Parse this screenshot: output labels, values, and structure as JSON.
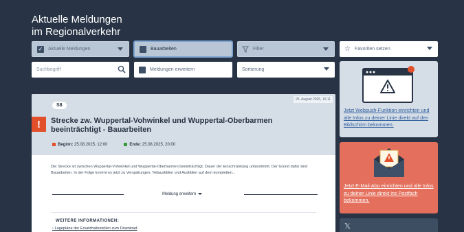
{
  "header": {
    "title_line1": "Aktuelle Meldungen",
    "title_line2": "im Regionalverkehr"
  },
  "filters": {
    "aktuelle": {
      "label": "Aktuelle Meldungen",
      "checked": true
    },
    "bauarbeiten": {
      "label": "Bauarbeiten",
      "checked": false
    },
    "filter": {
      "label": "Filter"
    },
    "favoriten": {
      "label": "Favoriten setzen"
    },
    "search": {
      "placeholder": "Suchbegriff"
    },
    "erweitern": {
      "label": "Meldungen erweitern",
      "checked": false
    },
    "sortierung": {
      "label": "Sortierung"
    }
  },
  "message": {
    "date": "25. August 2025, 16:11",
    "line": "S8",
    "title": "Strecke zw. Wuppertal-Vohwinkel und Wuppertal-Oberbarmen beeinträchtigt - Bauarbeiten",
    "begin_label": "Beginn:",
    "begin_value": "25.08.2025, 12:00",
    "end_label": "Ende:",
    "end_value": "25.08.2025, 20:00",
    "description": "Die Strecke ist zwischen Wuppertal-Vohwinkel und Wuppertal-Oberbarmen beeinträchtigt. Dauer der Einschränkung unbestimmt. Der Grund dafür sind Bauarbeiten. In der Folge kommt es jetzt zu Verspätungen, Teilausfällen und Ausfällen auf dem kompletten...",
    "expand_label": "Meldung erweitern",
    "more_info_heading": "WEITERE INFORMATIONEN:",
    "more_info_link": "Lagepläne der Ersatzhaltestellen zum Download"
  },
  "sidebar": {
    "push_link": "Jetzt Webpush-Funktion einrichten und alle Infos zu deiner Linie direkt auf den Bildschirm bekommen.",
    "mail_link": "Jetzt E-Mail-Abo einrichten und alle Infos zu deiner Linie direkt ins Postfach bekommen.",
    "social_icon": "x-icon"
  },
  "colors": {
    "background": "#283445",
    "alert": "#e2502b",
    "mail_panel": "#e46f5c",
    "link": "#2f5f9e"
  }
}
